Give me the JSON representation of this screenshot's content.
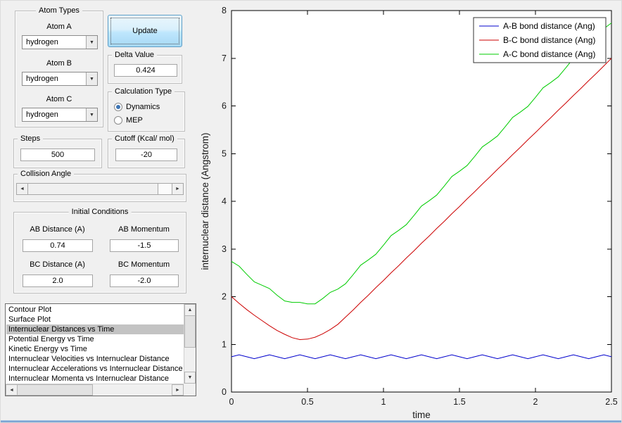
{
  "window": {
    "background": "#f0f0f0"
  },
  "icons": {
    "dropdown_arrow": "▼",
    "scroll_left": "◄",
    "scroll_right": "►",
    "scroll_up": "▲",
    "scroll_down": "▼"
  },
  "controls": {
    "atom_types": {
      "title": "Atom Types",
      "fields": [
        {
          "label": "Atom A",
          "value": "hydrogen"
        },
        {
          "label": "Atom B",
          "value": "hydrogen"
        },
        {
          "label": "Atom C",
          "value": "hydrogen"
        }
      ]
    },
    "update_button_label": "Update",
    "delta": {
      "title": "Delta Value",
      "value": "0.424"
    },
    "calculation_type": {
      "title": "Calculation Type",
      "options": [
        {
          "label": "Dynamics",
          "selected": true
        },
        {
          "label": "MEP",
          "selected": false
        }
      ]
    },
    "steps": {
      "title": "Steps",
      "value": "500"
    },
    "cutoff": {
      "title": "Cutoff (Kcal/ mol)",
      "value": "-20"
    },
    "collision_angle": {
      "title": "Collision Angle"
    },
    "initial_conditions": {
      "title": "Initial Conditions",
      "ab_distance": {
        "label": "AB Distance (A)",
        "value": "0.74"
      },
      "ab_momentum": {
        "label": "AB Momentum",
        "value": "-1.5"
      },
      "bc_distance": {
        "label": "BC Distance (A)",
        "value": "2.0"
      },
      "bc_momentum": {
        "label": "BC Momentum",
        "value": "-2.0"
      }
    },
    "plot_list": {
      "items": [
        "Contour Plot",
        "Surface Plot",
        "Internuclear Distances vs Time",
        "Potential Energy vs Time",
        "Kinetic Energy vs Time",
        "Internuclear Velocities vs Internuclear Distance",
        "Internuclear Accelerations vs Internuclear Distance",
        "Internuclear Momenta vs Internuclear Distance"
      ],
      "selected_index": 2
    }
  },
  "chart_data": {
    "type": "line",
    "title": "",
    "xlabel": "time",
    "ylabel": "internuclear distance (Angstrom)",
    "xlim": [
      0,
      2.5
    ],
    "ylim": [
      0,
      8
    ],
    "xticks": [
      0,
      0.5,
      1,
      1.5,
      2,
      2.5
    ],
    "yticks": [
      0,
      1,
      2,
      3,
      4,
      5,
      6,
      7,
      8
    ],
    "grid": false,
    "legend_position": "top-right",
    "x": [
      0,
      0.05,
      0.1,
      0.15,
      0.2,
      0.25,
      0.3,
      0.35,
      0.4,
      0.45,
      0.5,
      0.55,
      0.6,
      0.65,
      0.7,
      0.75,
      0.8,
      0.85,
      0.9,
      0.95,
      1,
      1.05,
      1.1,
      1.15,
      1.2,
      1.25,
      1.3,
      1.35,
      1.4,
      1.45,
      1.5,
      1.55,
      1.6,
      1.65,
      1.7,
      1.75,
      1.8,
      1.85,
      1.9,
      1.95,
      2,
      2.05,
      2.1,
      2.15,
      2.2,
      2.25,
      2.3,
      2.35,
      2.4,
      2.45,
      2.5
    ],
    "series": [
      {
        "name": "A-B bond distance (Ang)",
        "color": "#0000CC",
        "values": [
          0.74,
          0.78,
          0.74,
          0.7,
          0.74,
          0.78,
          0.74,
          0.7,
          0.74,
          0.78,
          0.74,
          0.7,
          0.74,
          0.78,
          0.74,
          0.7,
          0.74,
          0.78,
          0.74,
          0.7,
          0.74,
          0.78,
          0.74,
          0.7,
          0.74,
          0.78,
          0.74,
          0.7,
          0.74,
          0.78,
          0.74,
          0.7,
          0.74,
          0.78,
          0.74,
          0.7,
          0.74,
          0.78,
          0.74,
          0.7,
          0.74,
          0.78,
          0.74,
          0.7,
          0.74,
          0.78,
          0.74,
          0.7,
          0.74,
          0.78,
          0.74
        ]
      },
      {
        "name": "B-C bond distance (Ang)",
        "color": "#CC0000",
        "values": [
          2.0,
          1.86,
          1.73,
          1.61,
          1.5,
          1.39,
          1.29,
          1.21,
          1.14,
          1.1,
          1.11,
          1.15,
          1.22,
          1.31,
          1.42,
          1.57,
          1.72,
          1.88,
          2.03,
          2.19,
          2.34,
          2.5,
          2.65,
          2.81,
          2.96,
          3.12,
          3.27,
          3.43,
          3.58,
          3.74,
          3.89,
          4.05,
          4.2,
          4.36,
          4.51,
          4.67,
          4.82,
          4.98,
          5.13,
          5.29,
          5.44,
          5.6,
          5.75,
          5.91,
          6.06,
          6.22,
          6.37,
          6.53,
          6.68,
          6.84,
          7.0
        ]
      },
      {
        "name": "A-C bond distance (Ang)",
        "color": "#00CC00",
        "values": [
          2.74,
          2.64,
          2.47,
          2.31,
          2.24,
          2.17,
          2.03,
          1.91,
          1.88,
          1.88,
          1.85,
          1.85,
          1.96,
          2.09,
          2.16,
          2.27,
          2.46,
          2.66,
          2.77,
          2.89,
          3.08,
          3.28,
          3.39,
          3.51,
          3.7,
          3.9,
          4.01,
          4.13,
          4.32,
          4.52,
          4.63,
          4.75,
          4.94,
          5.14,
          5.25,
          5.37,
          5.56,
          5.76,
          5.87,
          5.99,
          6.18,
          6.38,
          6.49,
          6.61,
          6.8,
          7.0,
          7.11,
          7.23,
          7.42,
          7.62,
          7.74
        ]
      }
    ]
  }
}
